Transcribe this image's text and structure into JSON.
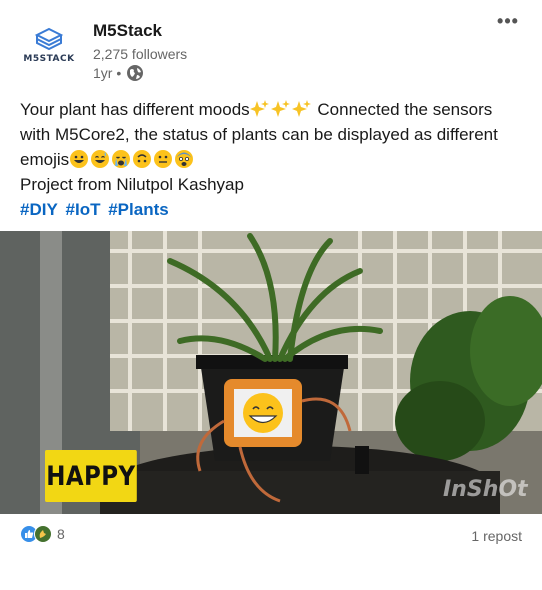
{
  "author": {
    "name": "M5Stack",
    "followers": "2,275 followers",
    "time": "1yr •",
    "logo_text": "M5STACK"
  },
  "post": {
    "line1": "Your plant has different moods",
    "line1_end": " Connected the sensors",
    "line2": "with M5Core2, the status of plants can be displayed as different",
    "line3_prefix": "emojis",
    "line4": "Project from Nilutpol Kashyap",
    "hashtags": [
      "#DIY",
      "#IoT",
      "#Plants"
    ]
  },
  "media": {
    "label": "HAPPY",
    "watermark": "InShOt"
  },
  "social": {
    "reaction_count": "8",
    "reposts": "1 repost"
  },
  "colors": {
    "hashtag": "#0a66c2",
    "happy_badge": "#f2d714",
    "like": "#378fe9",
    "celebrate": "#44712e"
  }
}
